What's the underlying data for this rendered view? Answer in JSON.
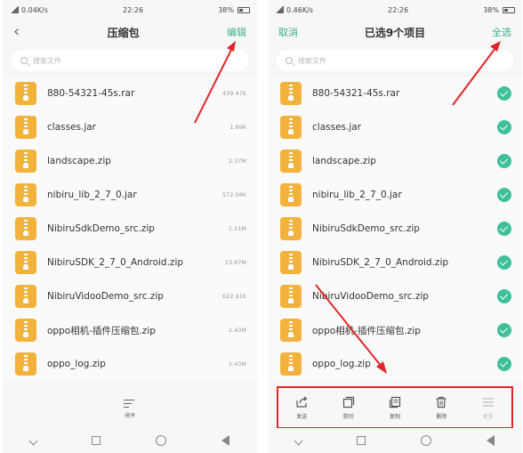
{
  "left": {
    "status": {
      "carrier": "0.04K/s",
      "time": "22:26",
      "battery": "38%"
    },
    "title": "压缩包",
    "edit_label": "编辑",
    "search_placeholder": "搜索文件",
    "files": [
      {
        "name": "880-54321-45s.rar",
        "size": "439.47K"
      },
      {
        "name": "classes.jar",
        "size": "1.89K"
      },
      {
        "name": "landscape.zip",
        "size": "2.37M"
      },
      {
        "name": "nibiru_lib_2_7_0.jar",
        "size": "572.58K"
      },
      {
        "name": "NibiruSdkDemo_src.zip",
        "size": "1.51M"
      },
      {
        "name": "NibiruSDK_2_7_0_Android.zip",
        "size": "13.87M"
      },
      {
        "name": "NibiruVidooDemo_src.zip",
        "size": "622.91K"
      },
      {
        "name": "oppo相机-插件压缩包.zip",
        "size": "2.43M"
      },
      {
        "name": "oppo_log.zip",
        "size": "1.43M"
      }
    ],
    "sort_label": "排序"
  },
  "right": {
    "status": {
      "carrier": "0.46K/s",
      "time": "22:26",
      "battery": "38%"
    },
    "cancel_label": "取消",
    "title": "已选9个项目",
    "select_all_label": "全选",
    "search_placeholder": "搜索文件",
    "files": [
      {
        "name": "880-54321-45s.rar"
      },
      {
        "name": "classes.jar"
      },
      {
        "name": "landscape.zip"
      },
      {
        "name": "nibiru_lib_2_7_0.jar"
      },
      {
        "name": "NibiruSdkDemo_src.zip"
      },
      {
        "name": "NibiruSDK_2_7_0_Android.zip"
      },
      {
        "name": "NibiruVidooDemo_src.zip"
      },
      {
        "name": "oppo相机-插件压缩包.zip"
      },
      {
        "name": "oppo_log.zip"
      }
    ],
    "actions": [
      {
        "label": "发送",
        "icon": "share-icon"
      },
      {
        "label": "剪切",
        "icon": "cut-icon"
      },
      {
        "label": "复制",
        "icon": "copy-icon"
      },
      {
        "label": "删除",
        "icon": "trash-icon"
      },
      {
        "label": "更多",
        "icon": "more-icon"
      }
    ]
  },
  "colors": {
    "accent": "#3fb08a",
    "file_icon": "#f2b23b",
    "highlight": "#e0262a"
  }
}
